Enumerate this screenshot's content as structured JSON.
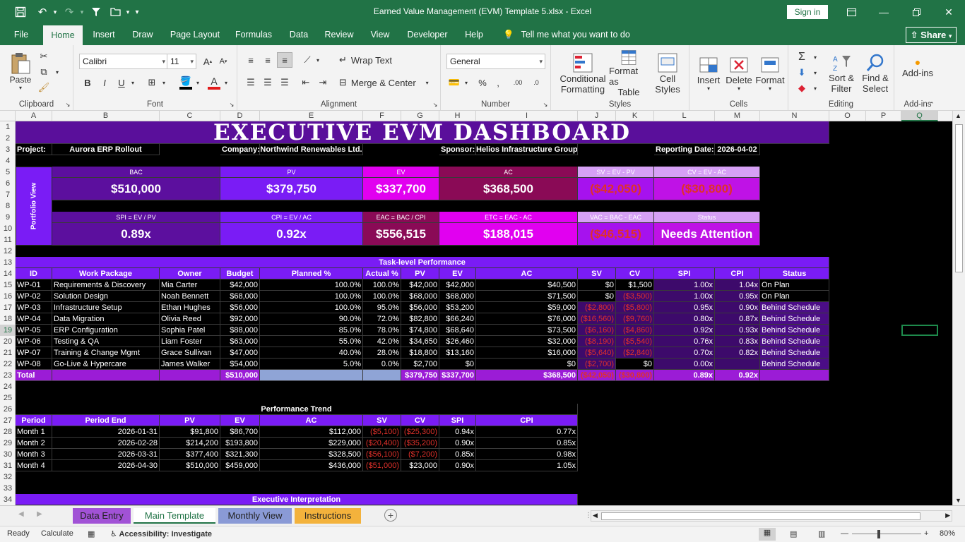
{
  "titlebar": {
    "title": "Earned Value Management (EVM) Template 5.xlsx  -  Excel",
    "signin": "Sign in"
  },
  "menu": {
    "tabs": [
      "File",
      "Home",
      "Insert",
      "Draw",
      "Page Layout",
      "Formulas",
      "Data",
      "Review",
      "View",
      "Developer",
      "Help"
    ],
    "tell_me": "Tell me what you want to do",
    "share": "Share"
  },
  "ribbon": {
    "clipboard": {
      "label": "Clipboard",
      "paste": "Paste"
    },
    "font": {
      "label": "Font",
      "name": "Calibri",
      "size": "11"
    },
    "alignment": {
      "label": "Alignment",
      "wrap": "Wrap Text",
      "merge": "Merge & Center"
    },
    "number": {
      "label": "Number",
      "format": "General"
    },
    "styles": {
      "label": "Styles",
      "cond1": "Conditional",
      "cond2": "Formatting",
      "fmt1": "Format as",
      "fmt2": "Table",
      "cell1": "Cell",
      "cell2": "Styles"
    },
    "cells": {
      "label": "Cells",
      "insert": "Insert",
      "delete": "Delete",
      "format": "Format"
    },
    "editing": {
      "label": "Editing",
      "sort1": "Sort &",
      "sort2": "Filter",
      "find1": "Find &",
      "find2": "Select"
    },
    "addins": {
      "label": "Add-ins",
      "btn": "Add-ins"
    }
  },
  "grid": {
    "columns": [
      "A",
      "B",
      "C",
      "D",
      "E",
      "F",
      "G",
      "H",
      "I",
      "J",
      "K",
      "L",
      "M",
      "N",
      "O",
      "P",
      "Q"
    ],
    "selected_column": "Q",
    "selected_row": "19"
  },
  "dashboard": {
    "title": "EXECUTIVE EVM DASHBOARD",
    "project_label": "Project:",
    "project": "Aurora ERP Rollout",
    "company_label": "Company:",
    "company": "Northwind Renewables Ltd.",
    "sponsor_label": "Sponsor:",
    "sponsor": "Helios Infrastructure Group",
    "date_label": "Reporting Date:",
    "date": "2026-04-02",
    "portfolio": "Portfolio View",
    "kpi_row1": [
      {
        "label": "BAC",
        "value": "$510,000",
        "bg": "#5c0f9e"
      },
      {
        "label": "PV",
        "value": "$379,750",
        "bg": "#7a1cf5"
      },
      {
        "label": "EV",
        "value": "$337,700",
        "bg": "#e100f0"
      },
      {
        "label": "AC",
        "value": "$368,500",
        "bg": "#8a0a56"
      },
      {
        "label": "SV = EV - PV",
        "value": "($42,050)",
        "bg": "#a612ee"
      },
      {
        "label": "CV = EV - AC",
        "value": "($30,800)",
        "bg": "#bf12e6"
      }
    ],
    "kpi_row2": [
      {
        "label": "SPI = EV / PV",
        "value": "0.89x",
        "bg": "#5c0f9e"
      },
      {
        "label": "CPI = EV / AC",
        "value": "0.92x",
        "bg": "#7a1cf5"
      },
      {
        "label": "EAC = BAC / CPI",
        "value": "$556,515",
        "bg": "#8a0a56"
      },
      {
        "label": "ETC = EAC - AC",
        "value": "$188,015",
        "bg": "#e100f0"
      },
      {
        "label": "VAC = BAC - EAC",
        "value": "($46,515)",
        "bg": "#a612ee"
      },
      {
        "label": "Status",
        "value": "Needs Attention",
        "bg": "#bf12e6"
      }
    ],
    "task_title": "Task-level Performance",
    "task_headers": [
      "ID",
      "Work Package",
      "Owner",
      "Budget",
      "Planned %",
      "Actual %",
      "PV",
      "EV",
      "AC",
      "SV",
      "CV",
      "SPI",
      "CPI",
      "Status"
    ],
    "tasks": [
      [
        "WP-01",
        "Requirements & Discovery",
        "Mia Carter",
        "$42,000",
        "100.0%",
        "100.0%",
        "$42,000",
        "$42,000",
        "$40,500",
        "$0",
        "$1,500",
        "1.00x",
        "1.04x",
        "On Plan"
      ],
      [
        "WP-02",
        "Solution Design",
        "Noah Bennett",
        "$68,000",
        "100.0%",
        "100.0%",
        "$68,000",
        "$68,000",
        "$71,500",
        "$0",
        "($3,500)",
        "1.00x",
        "0.95x",
        "On Plan"
      ],
      [
        "WP-03",
        "Infrastructure Setup",
        "Ethan Hughes",
        "$56,000",
        "100.0%",
        "95.0%",
        "$56,000",
        "$53,200",
        "$59,000",
        "($2,800)",
        "($5,800)",
        "0.95x",
        "0.90x",
        "Behind Schedule"
      ],
      [
        "WP-04",
        "Data Migration",
        "Olivia Reed",
        "$92,000",
        "90.0%",
        "72.0%",
        "$82,800",
        "$66,240",
        "$76,000",
        "($16,560)",
        "($9,760)",
        "0.80x",
        "0.87x",
        "Behind Schedule"
      ],
      [
        "WP-05",
        "ERP Configuration",
        "Sophia Patel",
        "$88,000",
        "85.0%",
        "78.0%",
        "$74,800",
        "$68,640",
        "$73,500",
        "($6,160)",
        "($4,860)",
        "0.92x",
        "0.93x",
        "Behind Schedule"
      ],
      [
        "WP-06",
        "Testing & QA",
        "Liam Foster",
        "$63,000",
        "55.0%",
        "42.0%",
        "$34,650",
        "$26,460",
        "$32,000",
        "($8,190)",
        "($5,540)",
        "0.76x",
        "0.83x",
        "Behind Schedule"
      ],
      [
        "WP-07",
        "Training & Change Mgmt",
        "Grace Sullivan",
        "$47,000",
        "40.0%",
        "28.0%",
        "$18,800",
        "$13,160",
        "$16,000",
        "($5,640)",
        "($2,840)",
        "0.70x",
        "0.82x",
        "Behind Schedule"
      ],
      [
        "WP-08",
        "Go-Live & Hypercare",
        "James Walker",
        "$54,000",
        "5.0%",
        "0.0%",
        "$2,700",
        "$0",
        "$0",
        "($2,700)",
        "$0",
        "0.00x",
        "",
        "Behind Schedule"
      ]
    ],
    "total": [
      "Total",
      "",
      "",
      "$510,000",
      "",
      "",
      "$379,750",
      "$337,700",
      "$368,500",
      "($42,050)",
      "($30,800)",
      "0.89x",
      "0.92x",
      ""
    ],
    "trend_title": "Performance Trend",
    "trend_headers": [
      "Period",
      "Period End",
      "PV",
      "EV",
      "AC",
      "SV",
      "CV",
      "SPI",
      "CPI"
    ],
    "trend": [
      [
        "Month 1",
        "2026-01-31",
        "$91,800",
        "$86,700",
        "$112,000",
        "($5,100)",
        "($25,300)",
        "0.94x",
        "0.77x"
      ],
      [
        "Month 2",
        "2026-02-28",
        "$214,200",
        "$193,800",
        "$229,000",
        "($20,400)",
        "($35,200)",
        "0.90x",
        "0.85x"
      ],
      [
        "Month 3",
        "2026-03-31",
        "$377,400",
        "$321,300",
        "$328,500",
        "($56,100)",
        "($7,200)",
        "0.85x",
        "0.98x"
      ],
      [
        "Month 4",
        "2026-04-30",
        "$510,000",
        "$459,000",
        "$436,000",
        "($51,000)",
        "$23,000",
        "0.90x",
        "1.05x"
      ]
    ],
    "interp_title": "Executive Interpretation"
  },
  "sheet_tabs": [
    {
      "label": "Data Entry",
      "bg": "#a152d6"
    },
    {
      "label": "Main Template",
      "bg": "#ffffff"
    },
    {
      "label": "Monthly View",
      "bg": "#8a9ad6"
    },
    {
      "label": "Instructions",
      "bg": "#f3b23c"
    }
  ],
  "status": {
    "ready": "Ready",
    "calc": "Calculate",
    "access": "Accessibility: Investigate",
    "zoom": "80%"
  }
}
